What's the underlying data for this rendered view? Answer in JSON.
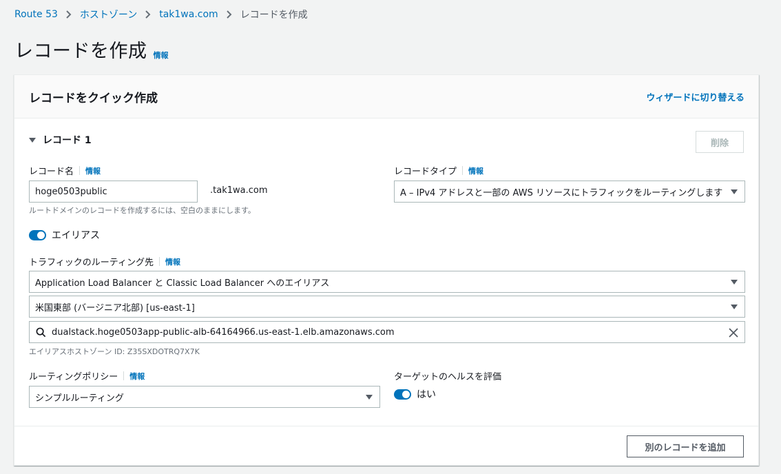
{
  "breadcrumb": {
    "items": [
      "Route 53",
      "ホストゾーン",
      "tak1wa.com",
      "レコードを作成"
    ]
  },
  "page": {
    "title": "レコードを作成",
    "info": "情報"
  },
  "card": {
    "title": "レコードをクイック作成",
    "wizard_link": "ウィザードに切り替える"
  },
  "record": {
    "section_title": "レコード 1",
    "delete_label": "削除",
    "name_label": "レコード名",
    "name_info": "情報",
    "name_value": "hoge0503public",
    "domain_suffix": ".tak1wa.com",
    "name_hint": "ルートドメインのレコードを作成するには、空白のままにします。",
    "type_label": "レコードタイプ",
    "type_info": "情報",
    "type_value": "A – IPv4 アドレスと一部の AWS リソースにトラフィックをルーティングします",
    "alias_label": "エイリアス",
    "alias_enabled": true,
    "route_label": "トラフィックのルーティング先",
    "route_info": "情報",
    "endpoint_value": "Application Load Balancer と Classic Load Balancer へのエイリアス",
    "region_value": "米国東部 (バージニア北部) [us-east-1]",
    "alb_value": "dualstack.hoge0503app-public-alb-64164966.us-east-1.elb.amazonaws.com",
    "hosted_zone_hint": "エイリアスホストゾーン ID: Z35SXDOTRQ7X7K",
    "policy_label": "ルーティングポリシー",
    "policy_info": "情報",
    "policy_value": "シンプルルーティング",
    "health_label": "ターゲットのヘルスを評価",
    "health_value": "はい",
    "health_enabled": true
  },
  "footer": {
    "add_record_label": "別のレコードを追加"
  },
  "colors": {
    "link": "#0073bb",
    "toggle_on": "#0073bb",
    "page_bg": "#f2f3f3"
  }
}
